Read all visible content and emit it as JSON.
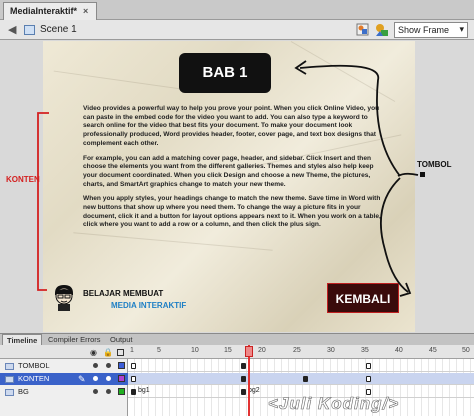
{
  "document_tab": {
    "label": "MediaInteraktif*",
    "close": "×"
  },
  "edit_bar": {
    "scene_label": "Scene 1",
    "zoom_value": "Show Frame"
  },
  "stage": {
    "title_box": "BAB 1",
    "paragraphs": [
      "Video provides a powerful way to help you prove your point. When you click Online Video, you can paste in the embed code for the video you want to add. You can also type a keyword to search online for the video that best fits your document. To make your document look professionally produced, Word provides header, footer, cover page, and text box designs that complement each other.",
      "For example, you can add a matching cover page, header, and sidebar. Click Insert and then choose the elements you want from the different galleries. Themes and styles also help keep your document coordinated. When you click Design and choose a new Theme, the pictures, charts, and SmartArt graphics change to match your new theme.",
      "When you apply styles, your headings change to match the new theme. Save time in Word with new buttons that show up where you need them. To change the way a picture fits in your document, click it and a button for layout options appears next to it. When you work on a table, click where you want to add a row or a column, and then click the plus sign."
    ],
    "brand_line1": "BELAJAR MEMBUAT",
    "brand_line2": "MEDIA INTERAKTIF",
    "back_button": "KEMBALI"
  },
  "annotations": {
    "konten": "KONTEN",
    "tombol": "TOMBOL"
  },
  "panel_tabs": [
    "Timeline",
    "Compiler Errors",
    "Output"
  ],
  "timeline": {
    "frame_numbers": [
      "1",
      "5",
      "10",
      "15",
      "20",
      "25",
      "30",
      "35",
      "40",
      "45",
      "50"
    ],
    "layers": [
      {
        "name": "TOMBOL",
        "color": "#3c5ed8"
      },
      {
        "name": "KONTEN",
        "color": "#b040d0"
      },
      {
        "name": "BG",
        "color": "#20b020"
      }
    ],
    "frame_labels": {
      "bg1": "bg1",
      "bg2": "bg2"
    },
    "current_frame": 21
  },
  "watermark": "<Juli Koding/>"
}
